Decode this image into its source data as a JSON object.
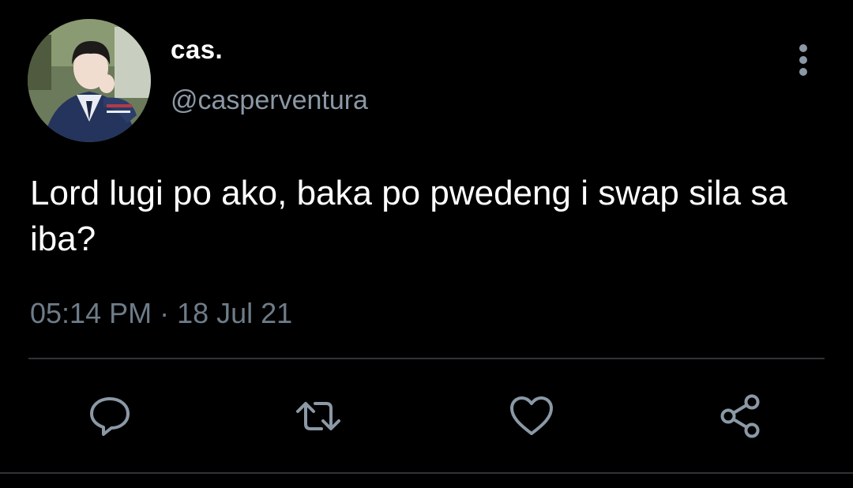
{
  "tweet": {
    "author": {
      "display_name": "cas.",
      "handle": "@casperventura"
    },
    "text": "Lord lugi po ako, baka po pwedeng i swap sila sa iba?",
    "timestamp": "05:14 PM · 18 Jul 21"
  },
  "icons": {
    "more": "more-vertical-icon",
    "reply": "reply-icon",
    "retweet": "retweet-icon",
    "like": "heart-icon",
    "share": "share-icon"
  },
  "colors": {
    "background": "#000000",
    "primary_text": "#ffffff",
    "secondary_text": "#8b98a5",
    "icon": "#8b98a5",
    "divider": "#2f3336"
  }
}
